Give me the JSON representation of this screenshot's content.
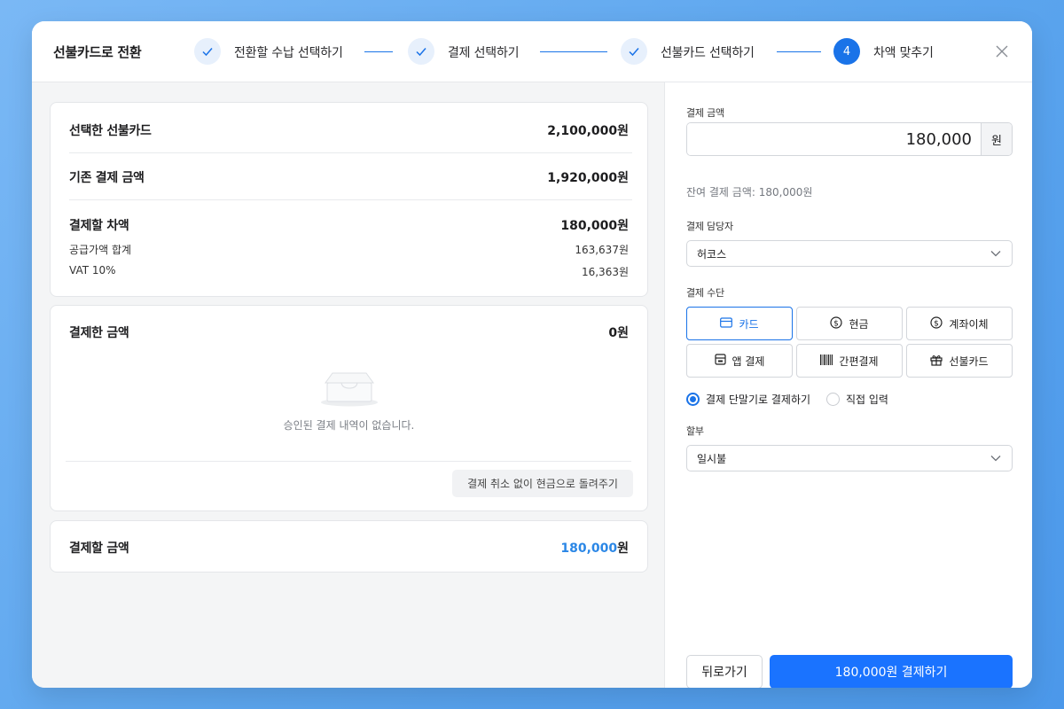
{
  "header": {
    "title": "선불카드로 전환",
    "steps": [
      {
        "label": "전환할 수납 선택하기",
        "state": "done"
      },
      {
        "label": "결제 선택하기",
        "state": "done"
      },
      {
        "label": "선불카드 선택하기",
        "state": "done"
      },
      {
        "label": "차액 맞추기",
        "state": "active",
        "number": "4"
      }
    ],
    "close_icon": "close-icon"
  },
  "summary": {
    "selected_card_label": "선택한 선불카드",
    "selected_card_value": "2,100,000원",
    "existing_payment_label": "기존 결제 금액",
    "existing_payment_value": "1,920,000원",
    "difference_label": "결제할 차액",
    "difference_value": "180,000원",
    "supply_label": "공급가액 합계",
    "supply_value": "163,637원",
    "vat_label": "VAT 10%",
    "vat_value": "16,363원"
  },
  "paid": {
    "label": "결제한 금액",
    "value": "0원",
    "empty_icon": "empty-tray-icon",
    "empty_message": "승인된 결제 내역이 없습니다.",
    "refund_button": "결제 취소 없이 현금으로 돌려주기"
  },
  "total": {
    "label": "결제할 금액",
    "amount": "180,000",
    "unit": "원"
  },
  "form": {
    "amount_label": "결제 금액",
    "amount_value": "180,000",
    "amount_unit": "원",
    "remaining_text": "잔여 결제 금액: 180,000원",
    "manager_label": "결제 담당자",
    "manager_value": "허코스",
    "method_label": "결제 수단",
    "methods": [
      {
        "label": "카드",
        "icon": "credit-card-icon",
        "selected": true
      },
      {
        "label": "현금",
        "icon": "dollar-circle-icon",
        "selected": false
      },
      {
        "label": "계좌이체",
        "icon": "dollar-circle-icon",
        "selected": false
      },
      {
        "label": "앱 결제",
        "icon": "app-payment-icon",
        "selected": false
      },
      {
        "label": "간편결제",
        "icon": "barcode-icon",
        "selected": false
      },
      {
        "label": "선불카드",
        "icon": "gift-icon",
        "selected": false
      }
    ],
    "radio_terminal": "결제 단말기로 결제하기",
    "radio_manual": "직접 입력",
    "installment_label": "할부",
    "installment_value": "일시불"
  },
  "footer": {
    "back_button": "뒤로가기",
    "pay_button": "180,000원 결제하기"
  },
  "colors": {
    "accent": "#1a73e8",
    "primary_button": "#1a73ff",
    "total_amount": "#2b87e6",
    "background_gradient": "#5da6ee"
  }
}
